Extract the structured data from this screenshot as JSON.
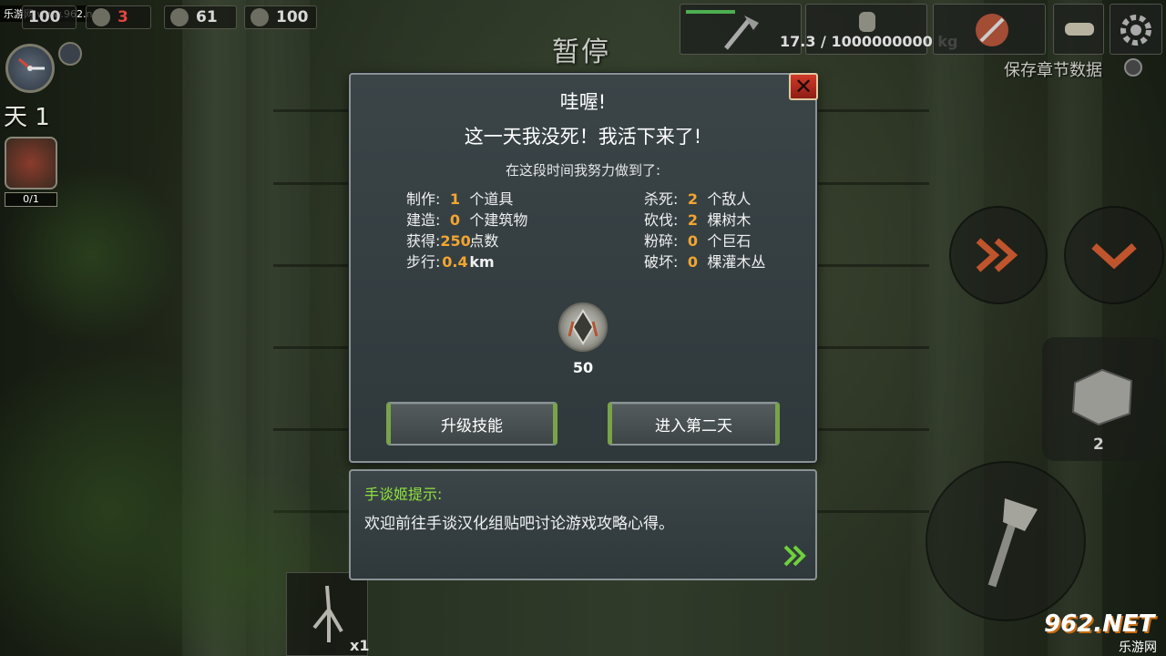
{
  "site_tag": "乐游网 www.962.net",
  "hud": {
    "health": "100",
    "threat": "3",
    "food": "61",
    "water": "100",
    "day": "天 1",
    "quest_progress": "0/1"
  },
  "pause_title": "暂停",
  "weight": "17.3 / 1000000000 kg",
  "save_label": "保存章节数据",
  "dialog": {
    "title1": "哇喔!",
    "title2": "这一天我没死！我活下来了!",
    "subtitle": "在这段时间我努力做到了:",
    "left_stats": [
      {
        "label": "制作:",
        "value": "1",
        "unit": "个道具"
      },
      {
        "label": "建造:",
        "value": "0",
        "unit": "个建筑物"
      },
      {
        "label": "获得:",
        "value": "250",
        "unit": "点数"
      },
      {
        "label": "步行:",
        "value": "0.4",
        "unit": "km"
      }
    ],
    "right_stats": [
      {
        "label": "杀死:",
        "value": "2",
        "unit": "个敌人"
      },
      {
        "label": "砍伐:",
        "value": "2",
        "unit": "棵树木"
      },
      {
        "label": "粉碎:",
        "value": "0",
        "unit": "个巨石"
      },
      {
        "label": "破坏:",
        "value": "0",
        "unit": "棵灌木丛"
      }
    ],
    "reward_value": "50",
    "upgrade_button": "升级技能",
    "next_day_button": "进入第二天",
    "close_icon": "close-icon"
  },
  "tip": {
    "title": "手谈姬提示:",
    "body": "欢迎前往手谈汉化组贴吧讨论游戏攻略心得。"
  },
  "stone_count": "2",
  "inventory_count": "x1",
  "watermark_text": "962.NET",
  "watermark_sub": "乐游网",
  "colors": {
    "stat_value": "#f3a531",
    "tip_title": "#8fe23e",
    "button_accent": "#79a34a",
    "close_red": "#d23a2a"
  }
}
